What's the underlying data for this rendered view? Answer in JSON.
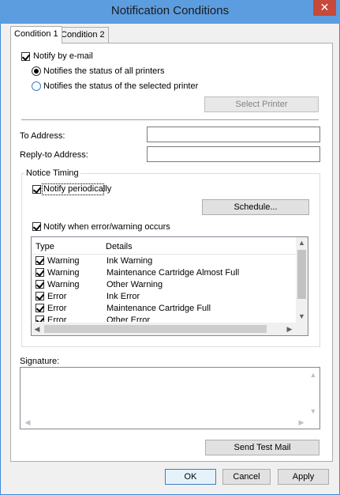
{
  "window": {
    "title": "Notification Conditions",
    "close_glyph": "✕"
  },
  "tabs": [
    {
      "label": "Condition 1",
      "active": true
    },
    {
      "label": "Condition 2",
      "active": false
    }
  ],
  "notify_email": {
    "label": "Notify by e-mail",
    "checked": true
  },
  "status_all": {
    "label": "Notifies the status of all printers",
    "checked": true
  },
  "status_selected": {
    "label": "Notifies the status of the selected printer",
    "checked": false
  },
  "select_printer": {
    "label": "Select Printer"
  },
  "to_address": {
    "label": "To Address:",
    "value": ""
  },
  "reply_address": {
    "label": "Reply-to Address:",
    "value": ""
  },
  "notice_timing": {
    "label": "Notice Timing",
    "periodic": {
      "label": "Notify periodically",
      "checked": true
    },
    "schedule_button": "Schedule...",
    "on_error": {
      "label": "Notify when error/warning occurs",
      "checked": true
    },
    "columns": [
      "Type",
      "Details"
    ],
    "rows": [
      {
        "type": "Warning",
        "details": "Ink Warning",
        "checked": true
      },
      {
        "type": "Warning",
        "details": "Maintenance Cartridge Almost Full",
        "checked": true
      },
      {
        "type": "Warning",
        "details": "Other Warning",
        "checked": true
      },
      {
        "type": "Error",
        "details": "Ink Error",
        "checked": true
      },
      {
        "type": "Error",
        "details": "Maintenance Cartridge Full",
        "checked": true
      },
      {
        "type": "Error",
        "details": "Other Error",
        "checked": true
      }
    ]
  },
  "signature": {
    "label": "Signature:",
    "value": ""
  },
  "send_test_mail": "Send Test Mail",
  "footer": {
    "ok": "OK",
    "cancel": "Cancel",
    "apply": "Apply"
  },
  "colors": {
    "titlebar": "#5c9de0",
    "close": "#c7493a",
    "frame": "#3f8bd9"
  }
}
